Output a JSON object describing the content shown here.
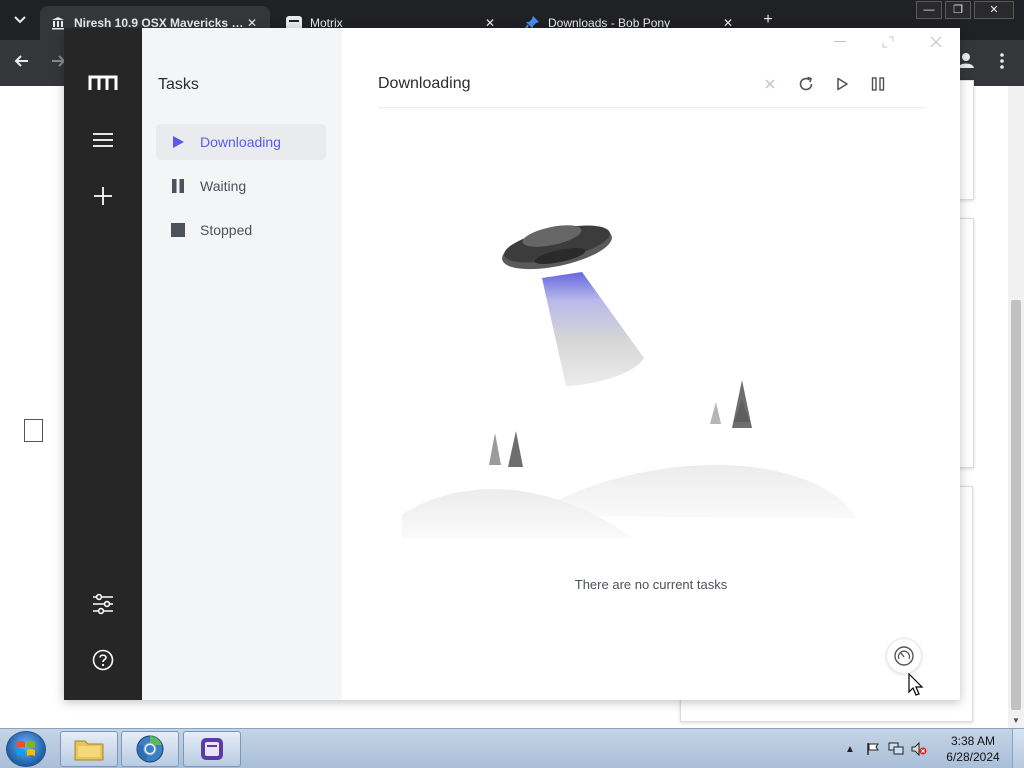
{
  "browser": {
    "tabs": [
      {
        "title": "Niresh 10.9 OSX Mavericks : N",
        "icon": "institution-icon",
        "close": "✕"
      },
      {
        "title": "Motrix",
        "icon": "motrix-tab-icon",
        "close": "✕"
      },
      {
        "title": "Downloads - Bob Pony",
        "icon": "pin-icon",
        "close": "✕"
      }
    ],
    "new_tab": "+",
    "window_buttons": {
      "minimize": "—",
      "maximize": "❐",
      "close": "✕"
    }
  },
  "app": {
    "subnav": {
      "title": "Tasks",
      "items": [
        {
          "label": "Downloading",
          "icon": "play-icon"
        },
        {
          "label": "Waiting",
          "icon": "pause-icon"
        },
        {
          "label": "Stopped",
          "icon": "stop-icon"
        }
      ]
    },
    "main": {
      "title": "Downloading",
      "empty_text": "There are no current tasks"
    },
    "colors": {
      "accent": "#5b5bea",
      "sidebar": "#262626"
    }
  },
  "taskbar": {
    "time": "3:38 AM",
    "date": "6/28/2024"
  }
}
